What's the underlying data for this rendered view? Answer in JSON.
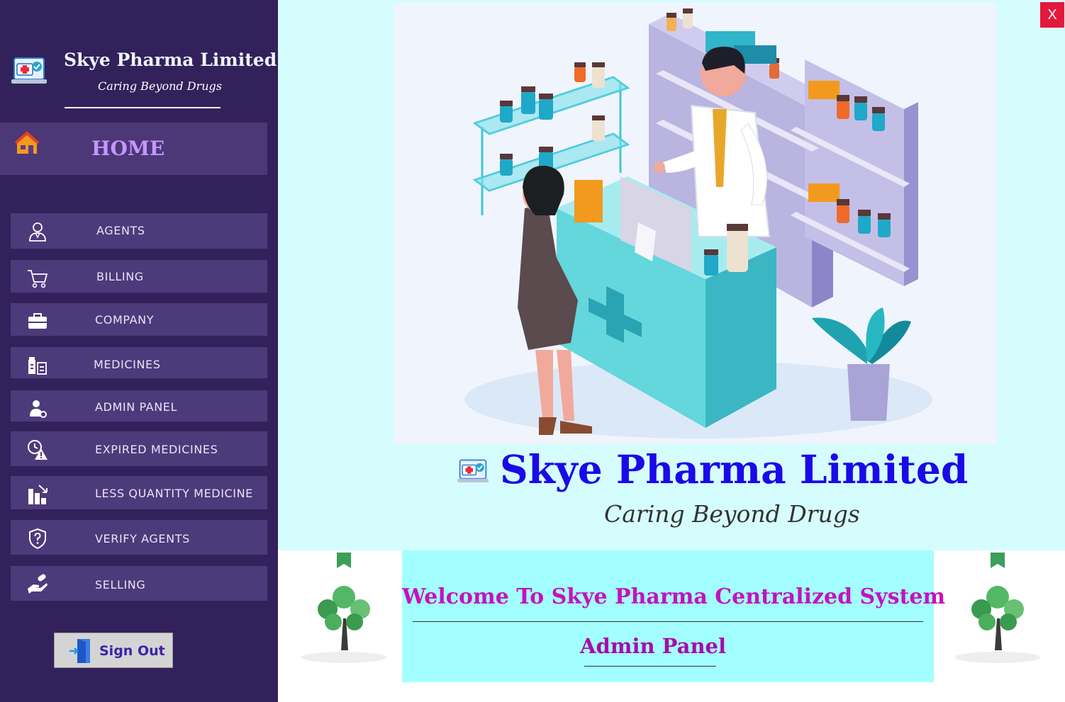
{
  "sidebar": {
    "app_name": "Skye Pharma Limited",
    "tagline": "Caring Beyond Drugs",
    "home_label": "HOME",
    "items": [
      {
        "label": "AGENTS",
        "icon": "agent-icon"
      },
      {
        "label": "BILLING",
        "icon": "cart-icon"
      },
      {
        "label": "COMPANY",
        "icon": "briefcase-icon"
      },
      {
        "label": "MEDICINES",
        "icon": "medicine-bottles-icon"
      },
      {
        "label": "ADMIN PANEL",
        "icon": "admin-user-icon"
      },
      {
        "label": "EXPIRED MEDICINES",
        "icon": "expired-warning-icon"
      },
      {
        "label": "LESS QUANTITY MEDICINE",
        "icon": "bar-decrease-icon"
      },
      {
        "label": "VERIFY AGENTS",
        "icon": "shield-question-icon"
      },
      {
        "label": "SELLING",
        "icon": "hand-pill-icon"
      }
    ],
    "signout_label": "Sign Out"
  },
  "main": {
    "close_label": "X",
    "brand_name": "Skye Pharma Limited",
    "brand_tagline": "Caring Beyond Drugs",
    "welcome_title": "Welcome To Skye Pharma Centralized System",
    "welcome_subtitle": "Admin Panel"
  },
  "colors": {
    "sidebar_bg": "#33215b",
    "nav_item_bg": "#4d3a7a",
    "home_label": "#c596ff",
    "brand_blue": "#1a0ae8",
    "welcome_magenta": "#c412bd",
    "welcome_bg": "#a3ffff",
    "hero_bg": "#d6fdfd",
    "close_red": "#e3183c"
  }
}
